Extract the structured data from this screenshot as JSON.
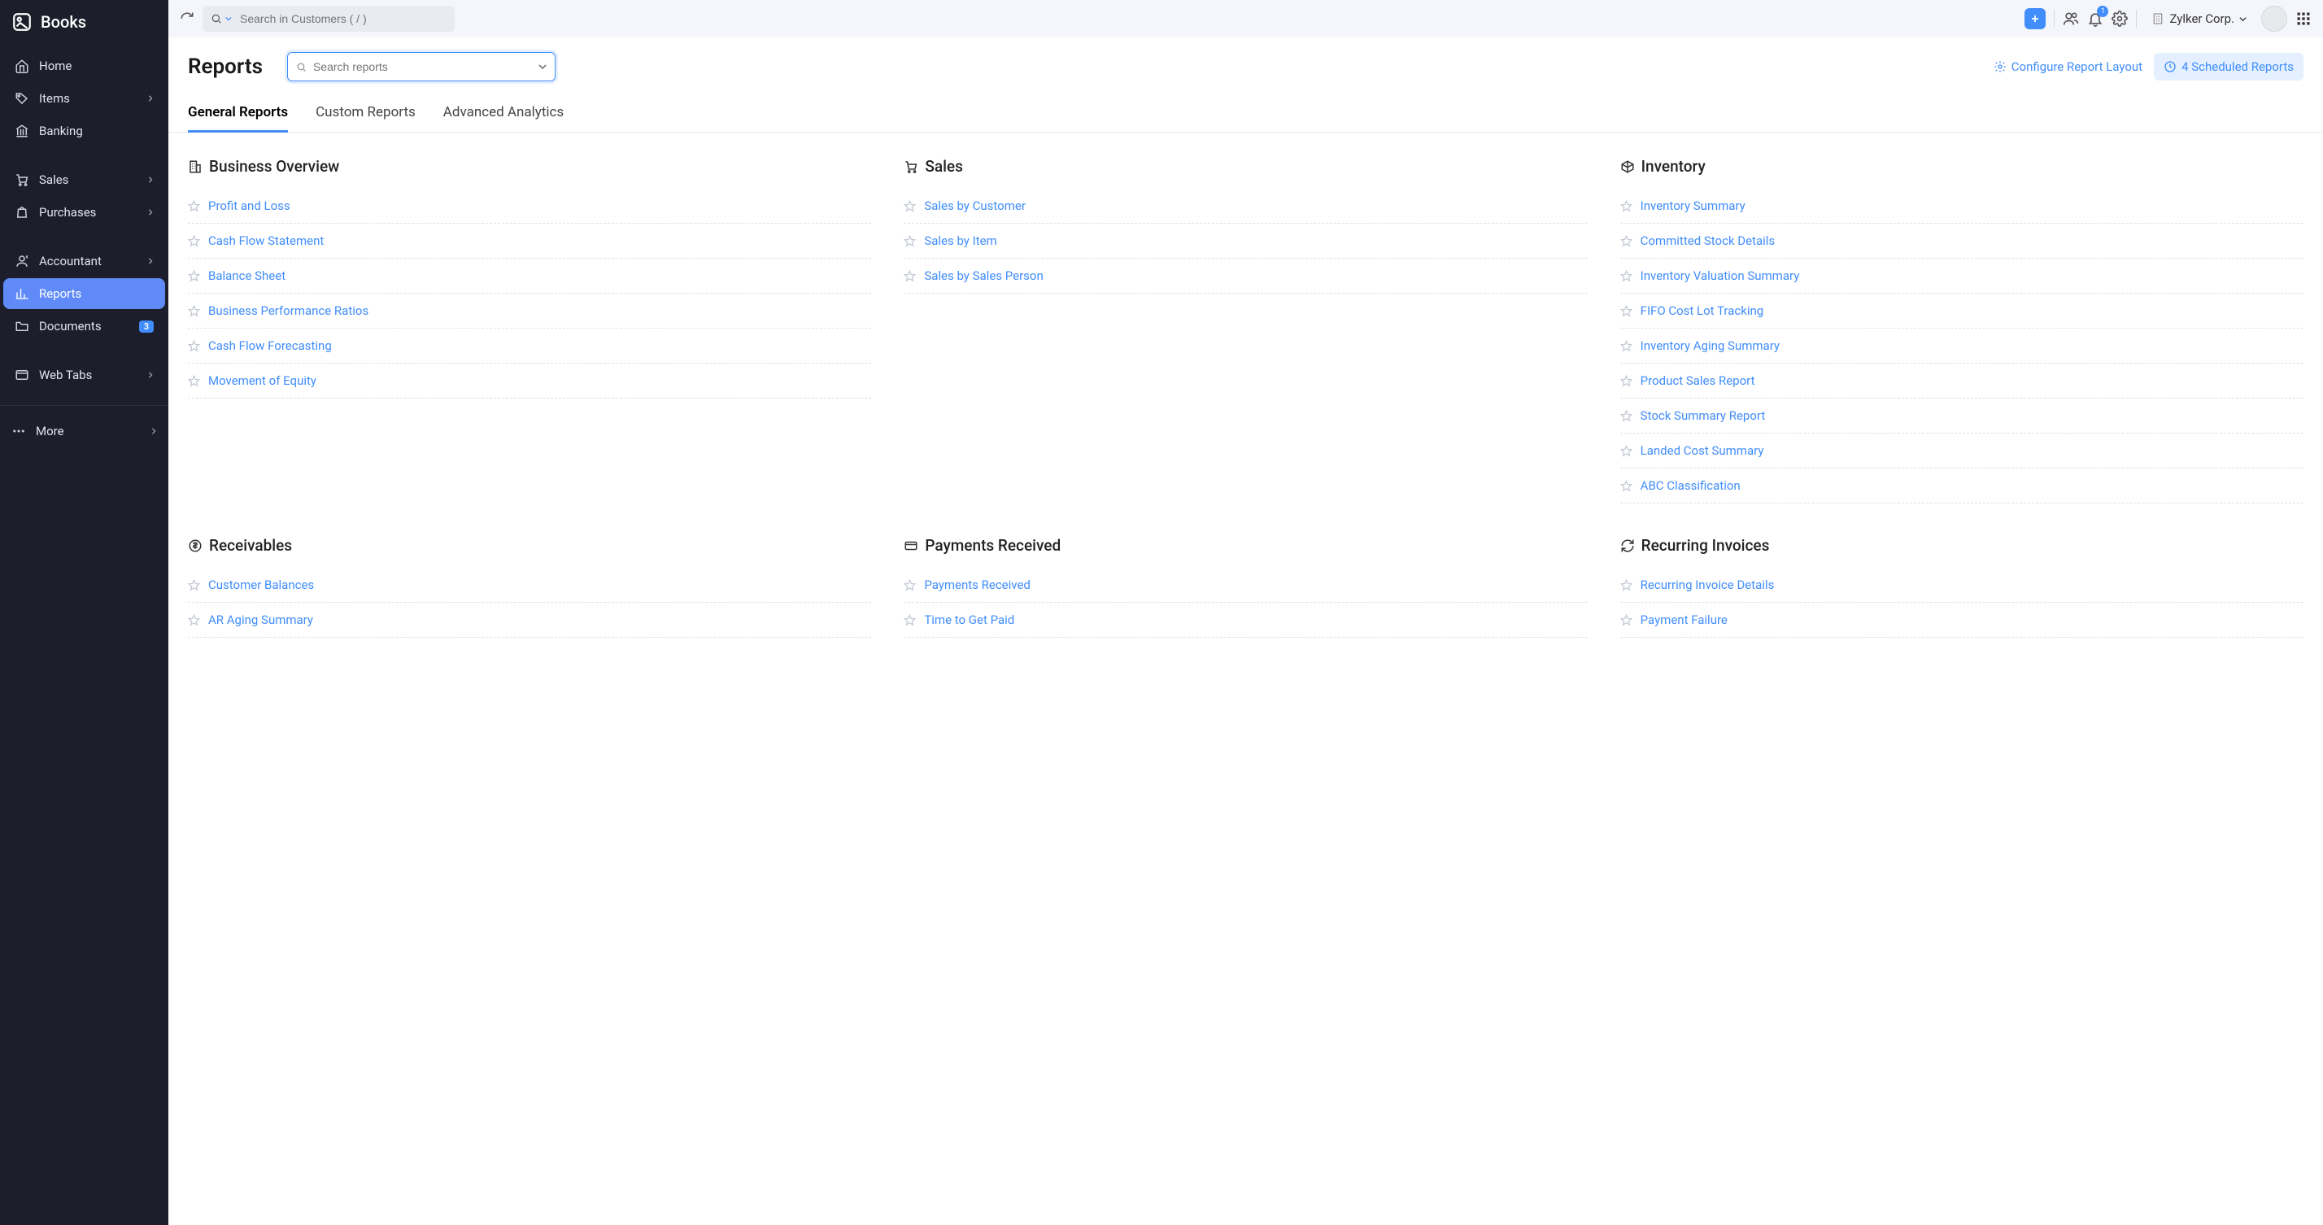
{
  "brand": "Books",
  "sidebar": {
    "items": [
      {
        "label": "Home",
        "icon": "home"
      },
      {
        "label": "Items",
        "icon": "tag",
        "expandable": true
      },
      {
        "label": "Banking",
        "icon": "bank"
      },
      {
        "label": "Sales",
        "icon": "cart",
        "expandable": true
      },
      {
        "label": "Purchases",
        "icon": "bag",
        "expandable": true
      },
      {
        "label": "Accountant",
        "icon": "accountant",
        "expandable": true
      },
      {
        "label": "Reports",
        "icon": "reports",
        "active": true
      },
      {
        "label": "Documents",
        "icon": "folder",
        "badge": "3"
      },
      {
        "label": "Web Tabs",
        "icon": "webtabs",
        "expandable": true
      }
    ],
    "more_label": "More"
  },
  "topbar": {
    "search_placeholder": "Search in Customers ( / )",
    "notif_count": "1",
    "org_name": "Zylker Corp."
  },
  "page": {
    "title": "Reports",
    "search_placeholder": "Search reports",
    "configure_label": "Configure Report Layout",
    "scheduled_label": "4 Scheduled Reports"
  },
  "tabs": [
    "General Reports",
    "Custom Reports",
    "Advanced Analytics"
  ],
  "columns": [
    [
      {
        "title": "Business Overview",
        "icon": "building",
        "items": [
          "Profit and Loss",
          "Cash Flow Statement",
          "Balance Sheet",
          "Business Performance Ratios",
          "Cash Flow Forecasting",
          "Movement of Equity"
        ]
      },
      {
        "title": "Receivables",
        "icon": "receivables",
        "items": [
          "Customer Balances",
          "AR Aging Summary"
        ]
      }
    ],
    [
      {
        "title": "Sales",
        "icon": "cart",
        "items": [
          "Sales by Customer",
          "Sales by Item",
          "Sales by Sales Person"
        ]
      },
      {
        "title": "Payments Received",
        "icon": "card",
        "items": [
          "Payments Received",
          "Time to Get Paid"
        ]
      }
    ],
    [
      {
        "title": "Inventory",
        "icon": "inventory",
        "items": [
          "Inventory Summary",
          "Committed Stock Details",
          "Inventory Valuation Summary",
          "FIFO Cost Lot Tracking",
          "Inventory Aging Summary",
          "Product Sales Report",
          "Stock Summary Report",
          "Landed Cost Summary",
          "ABC Classification"
        ]
      },
      {
        "title": "Recurring Invoices",
        "icon": "recurring",
        "items": [
          "Recurring Invoice Details",
          "Payment Failure"
        ]
      }
    ]
  ]
}
